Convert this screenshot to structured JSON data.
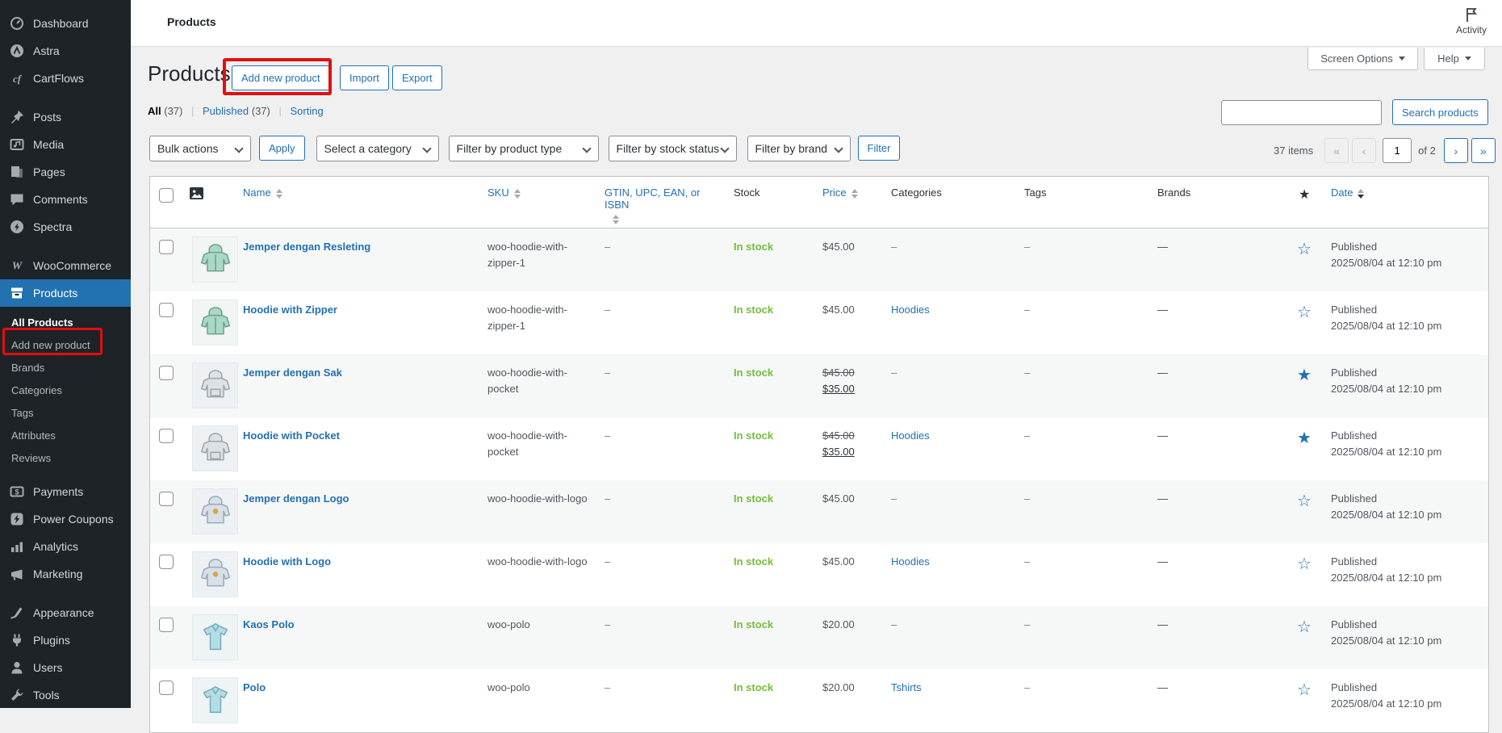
{
  "colors": {
    "accent": "#2271b1",
    "instock_green": "#72bf3a",
    "annotation_red": "#e20e10",
    "sidebar_bg": "#1d2327"
  },
  "topbar": {
    "title": "Products",
    "activity_label": "Activity"
  },
  "meta_tabs": {
    "screen_options": "Screen Options",
    "help": "Help"
  },
  "page": {
    "title": "Products",
    "actions": [
      {
        "label": "Add new product"
      },
      {
        "label": "Import"
      },
      {
        "label": "Export"
      }
    ],
    "views": [
      {
        "label": "All",
        "count": "(37)",
        "current": true
      },
      {
        "label": "Published",
        "count": "(37)",
        "current": false
      },
      {
        "label": "Sorting",
        "count": "",
        "current": false
      }
    ],
    "views_separator": "|",
    "search": {
      "value": "",
      "button": "Search products"
    }
  },
  "filters": {
    "bulk_actions": "Bulk actions",
    "apply": "Apply",
    "selects": [
      "Select a category",
      "Filter by product type",
      "Filter by stock status",
      "Filter by brand"
    ],
    "filter_button": "Filter"
  },
  "pagination": {
    "items": "37 items",
    "first": "«",
    "prev": "‹",
    "current": "1",
    "of": "of 2",
    "next": "›",
    "last": "»"
  },
  "sidebar": {
    "items": [
      {
        "label": "Dashboard",
        "icon": "dashboard"
      },
      {
        "label": "Astra",
        "icon": "astra"
      },
      {
        "label": "CartFlows",
        "icon": "cartflows"
      },
      {
        "label": "Posts",
        "icon": "posts",
        "gap": true
      },
      {
        "label": "Media",
        "icon": "media"
      },
      {
        "label": "Pages",
        "icon": "pages"
      },
      {
        "label": "Comments",
        "icon": "comments"
      },
      {
        "label": "Spectra",
        "icon": "spectra"
      },
      {
        "label": "WooCommerce",
        "icon": "woocommerce",
        "gap": true
      },
      {
        "label": "Products",
        "icon": "products",
        "active": true
      }
    ],
    "submenu": [
      {
        "label": "All Products",
        "current": true
      },
      {
        "label": "Add new product",
        "annotated": true
      },
      {
        "label": "Brands"
      },
      {
        "label": "Categories"
      },
      {
        "label": "Tags"
      },
      {
        "label": "Attributes"
      },
      {
        "label": "Reviews"
      }
    ],
    "items_after": [
      {
        "label": "Payments",
        "icon": "payments"
      },
      {
        "label": "Power Coupons",
        "icon": "coupons"
      },
      {
        "label": "Analytics",
        "icon": "analytics"
      },
      {
        "label": "Marketing",
        "icon": "marketing"
      },
      {
        "label": "Appearance",
        "icon": "appearance",
        "gap": true
      },
      {
        "label": "Plugins",
        "icon": "plugins"
      },
      {
        "label": "Users",
        "icon": "users"
      },
      {
        "label": "Tools",
        "icon": "tools"
      }
    ]
  },
  "table": {
    "columns": [
      {
        "id": "cb"
      },
      {
        "id": "image"
      },
      {
        "id": "name",
        "label": "Name",
        "sortable": true
      },
      {
        "id": "sku",
        "label": "SKU",
        "sortable": true
      },
      {
        "id": "gtin",
        "label": "GTIN, UPC, EAN, or ISBN",
        "sortable": true,
        "arrows_below": true
      },
      {
        "id": "stock",
        "label": "Stock"
      },
      {
        "id": "price",
        "label": "Price",
        "sortable": true
      },
      {
        "id": "categories",
        "label": "Categories"
      },
      {
        "id": "tags",
        "label": "Tags"
      },
      {
        "id": "brands",
        "label": "Brands"
      },
      {
        "id": "featured",
        "label": "★"
      },
      {
        "id": "date",
        "label": "Date",
        "sortable": true,
        "sorted": "desc"
      }
    ],
    "rows": [
      {
        "name": "Jemper dengan Resleting",
        "sku": "woo-hoodie-with-zipper-1",
        "gtin": "–",
        "stock": "In stock",
        "price_regular": "$45.00",
        "price_sale": "",
        "category": "–",
        "category_is_link": false,
        "tags": "–",
        "brands": "—",
        "featured": false,
        "status": "Published",
        "date": "2025/08/04 at 12:10 pm",
        "thumb": "hoodie-zipper"
      },
      {
        "name": "Hoodie with Zipper",
        "sku": "woo-hoodie-with-zipper-1",
        "gtin": "–",
        "stock": "In stock",
        "price_regular": "$45.00",
        "price_sale": "",
        "category": "Hoodies",
        "category_is_link": true,
        "tags": "–",
        "brands": "—",
        "featured": false,
        "status": "Published",
        "date": "2025/08/04 at 12:10 pm",
        "thumb": "hoodie-zipper"
      },
      {
        "name": "Jemper dengan Sak",
        "sku": "woo-hoodie-with-pocket",
        "gtin": "–",
        "stock": "In stock",
        "price_regular": "$45.00",
        "price_sale": "$35.00",
        "category": "–",
        "category_is_link": false,
        "tags": "–",
        "brands": "—",
        "featured": true,
        "status": "Published",
        "date": "2025/08/04 at 12:10 pm",
        "thumb": "hoodie-pocket"
      },
      {
        "name": "Hoodie with Pocket",
        "sku": "woo-hoodie-with-pocket",
        "gtin": "–",
        "stock": "In stock",
        "price_regular": "$45.00",
        "price_sale": "$35.00",
        "category": "Hoodies",
        "category_is_link": true,
        "tags": "–",
        "brands": "—",
        "featured": true,
        "status": "Published",
        "date": "2025/08/04 at 12:10 pm",
        "thumb": "hoodie-pocket"
      },
      {
        "name": "Jemper dengan Logo",
        "sku": "woo-hoodie-with-logo",
        "gtin": "–",
        "stock": "In stock",
        "price_regular": "$45.00",
        "price_sale": "",
        "category": "–",
        "category_is_link": false,
        "tags": "–",
        "brands": "—",
        "featured": false,
        "status": "Published",
        "date": "2025/08/04 at 12:10 pm",
        "thumb": "hoodie-logo"
      },
      {
        "name": "Hoodie with Logo",
        "sku": "woo-hoodie-with-logo",
        "gtin": "–",
        "stock": "In stock",
        "price_regular": "$45.00",
        "price_sale": "",
        "category": "Hoodies",
        "category_is_link": true,
        "tags": "–",
        "brands": "—",
        "featured": false,
        "status": "Published",
        "date": "2025/08/04 at 12:10 pm",
        "thumb": "hoodie-logo"
      },
      {
        "name": "Kaos Polo",
        "sku": "woo-polo",
        "gtin": "–",
        "stock": "In stock",
        "price_regular": "$20.00",
        "price_sale": "",
        "category": "–",
        "category_is_link": false,
        "tags": "–",
        "brands": "—",
        "featured": false,
        "status": "Published",
        "date": "2025/08/04 at 12:10 pm",
        "thumb": "polo"
      },
      {
        "name": "Polo",
        "sku": "woo-polo",
        "gtin": "–",
        "stock": "In stock",
        "price_regular": "$20.00",
        "price_sale": "",
        "category": "Tshirts",
        "category_is_link": true,
        "tags": "–",
        "brands": "—",
        "featured": false,
        "status": "Published",
        "date": "2025/08/04 at 12:10 pm",
        "thumb": "polo"
      }
    ],
    "thumbs": {
      "hoodie-zipper": {
        "bg": "#f1f5f3",
        "fill": "#a9d9c6",
        "stroke": "#6b9c87",
        "feature": "zipper"
      },
      "hoodie-pocket": {
        "bg": "#eef1f4",
        "fill": "#dde1e4",
        "stroke": "#9aa2a9",
        "feature": "pocket"
      },
      "hoodie-logo": {
        "bg": "#eef1f4",
        "fill": "#d7dfe7",
        "stroke": "#93a7b7",
        "feature": "logo"
      },
      "polo": {
        "bg": "#eef3f5",
        "fill": "#b3dce6",
        "stroke": "#76a9b6",
        "feature": "polo"
      }
    }
  }
}
